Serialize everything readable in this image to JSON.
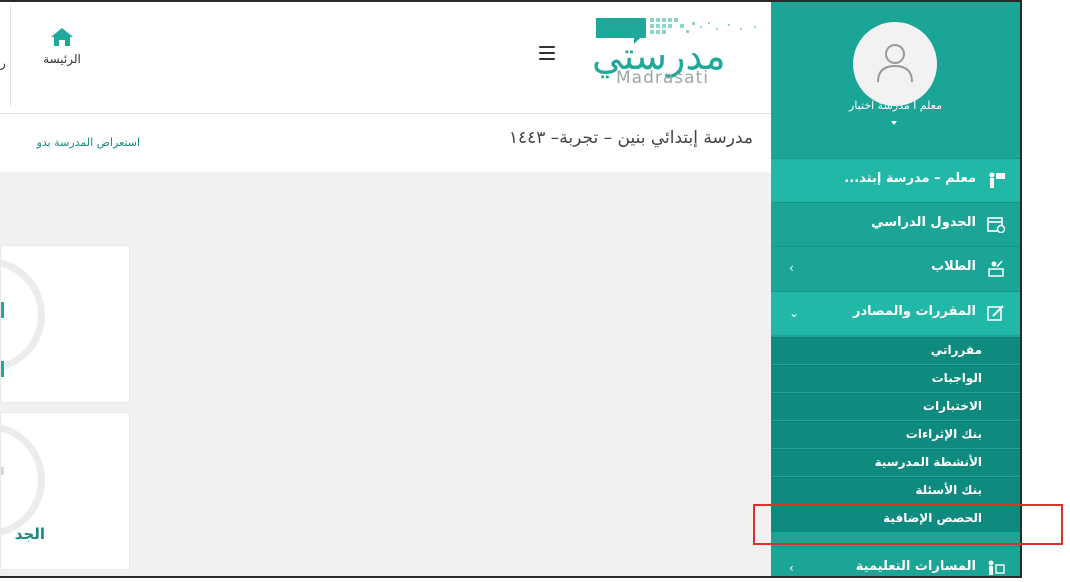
{
  "topbar": {
    "home_label": "الرئيسة",
    "home_cut": "ر",
    "logo_ar": "مدرستي",
    "logo_en": "Madrasati"
  },
  "school": {
    "name": "مدرسة إبتدائي بنين – تجربة– ١٤٤٣",
    "link": "استعراض المدرسة بدو"
  },
  "cards": [
    {
      "title": ""
    },
    {
      "title": "الجد"
    }
  ],
  "sidebar": {
    "user_name": "معلم ا مدرسة اختبار",
    "items": [
      {
        "label": "معلم – مدرسة إبتد...",
        "icon": "teacher-icon",
        "chevron": ""
      },
      {
        "label": "الجدول الدراسي",
        "icon": "calendar-icon",
        "chevron": ""
      },
      {
        "label": "الطلاب",
        "icon": "students-icon",
        "chevron": "‹"
      },
      {
        "label": "المقررات والمصادر",
        "icon": "edit-icon",
        "chevron": "⌄"
      },
      {
        "label": "المسارات التعليمية",
        "icon": "paths-icon",
        "chevron": "‹"
      }
    ],
    "subitems": [
      {
        "label": "مقرراتي"
      },
      {
        "label": "الواجبات"
      },
      {
        "label": "الاختبارات"
      },
      {
        "label": "بنك الإثراءات"
      },
      {
        "label": "الأنشطة المدرسية"
      },
      {
        "label": "بنك الأسئلة"
      },
      {
        "label": "الحصص الإضافية"
      }
    ]
  },
  "colors": {
    "brand": "#1ba597",
    "submenu": "#0f8a7f",
    "highlight": "#e0302a"
  }
}
